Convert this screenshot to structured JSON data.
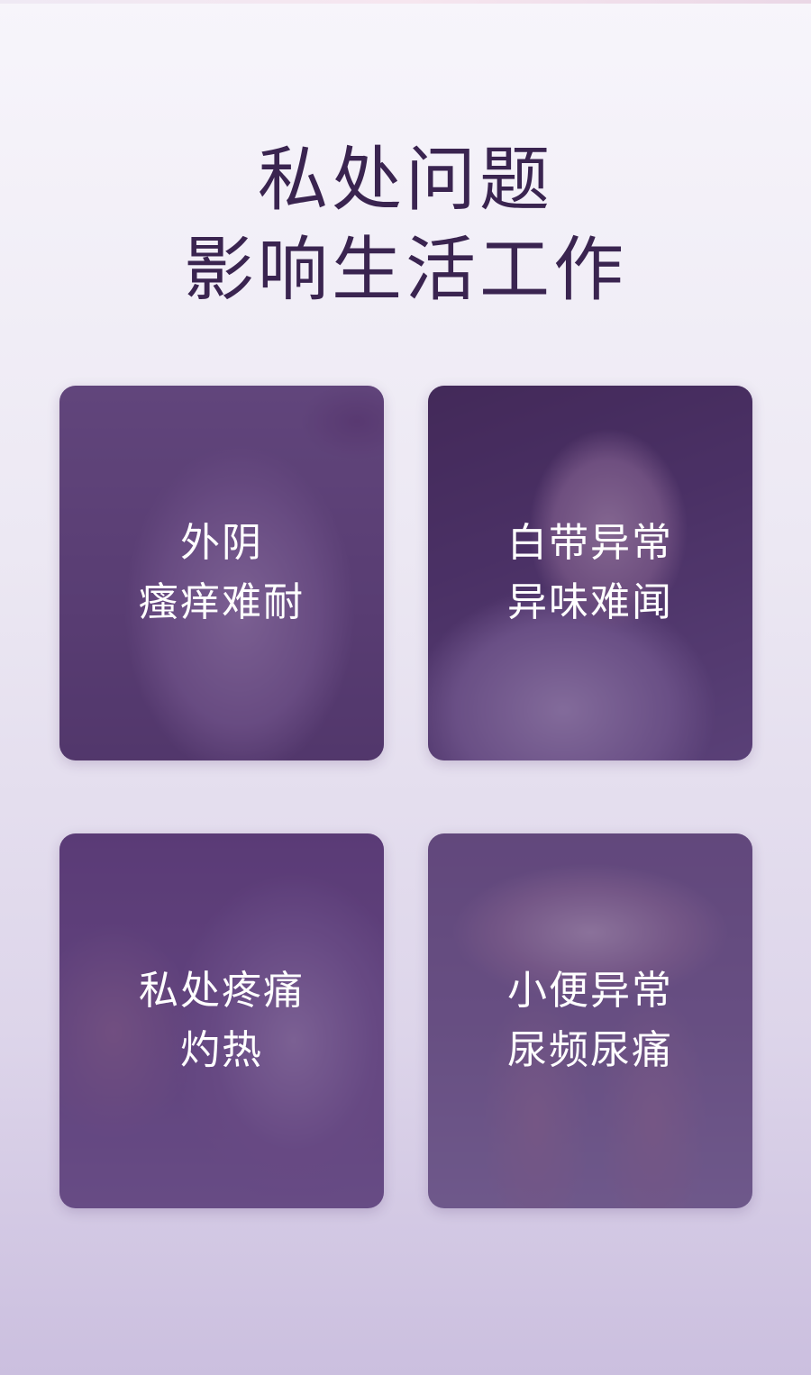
{
  "headline": {
    "line1": "私处问题",
    "line2": "影响生活工作"
  },
  "cards": [
    {
      "line1": "外阴",
      "line2": "瘙痒难耐"
    },
    {
      "line1": "白带异常",
      "line2": "异味难闻"
    },
    {
      "line1": "私处疼痛",
      "line2": "灼热"
    },
    {
      "line1": "小便异常",
      "line2": "尿频尿痛"
    }
  ],
  "colors": {
    "headline_text": "#3a2450",
    "card_overlay": "#4a2c6a",
    "card_text": "#ffffff",
    "background_top": "#f7f5fb",
    "background_bottom": "#cbbfdf"
  }
}
